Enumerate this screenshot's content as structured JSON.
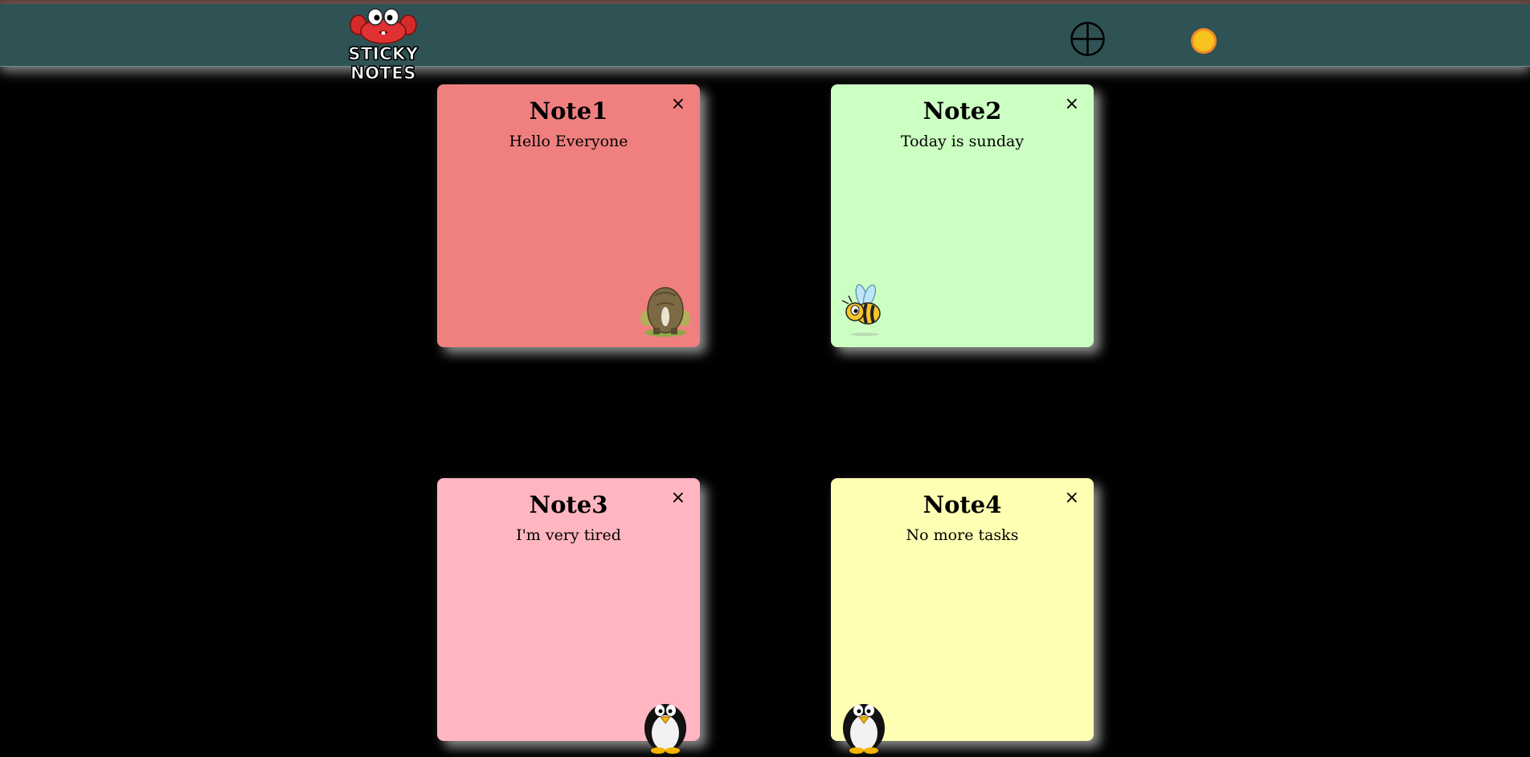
{
  "app": {
    "title": "STICKY NOTES",
    "logo_icon": "crab-icon"
  },
  "toolbar": {
    "add_icon": "plus-circle-icon",
    "theme_icon": "sun-icon"
  },
  "colors": {
    "header_bg": "#2f5254",
    "page_bg": "#000000",
    "note1": "#f08080",
    "note2": "#ccffc2",
    "note3": "#ffb6c1",
    "note4": "#ffffb3",
    "sun": "#f5b400"
  },
  "notes": [
    {
      "title": "Note1",
      "body": "Hello Everyone",
      "close": "×",
      "sticker": "elephant-icon"
    },
    {
      "title": "Note2",
      "body": "Today is sunday",
      "close": "×",
      "sticker": "bee-icon"
    },
    {
      "title": "Note3",
      "body": "I'm very tired",
      "close": "×",
      "sticker": "penguin-icon"
    },
    {
      "title": "Note4",
      "body": "No more tasks",
      "close": "×",
      "sticker": "penguin-icon"
    }
  ]
}
